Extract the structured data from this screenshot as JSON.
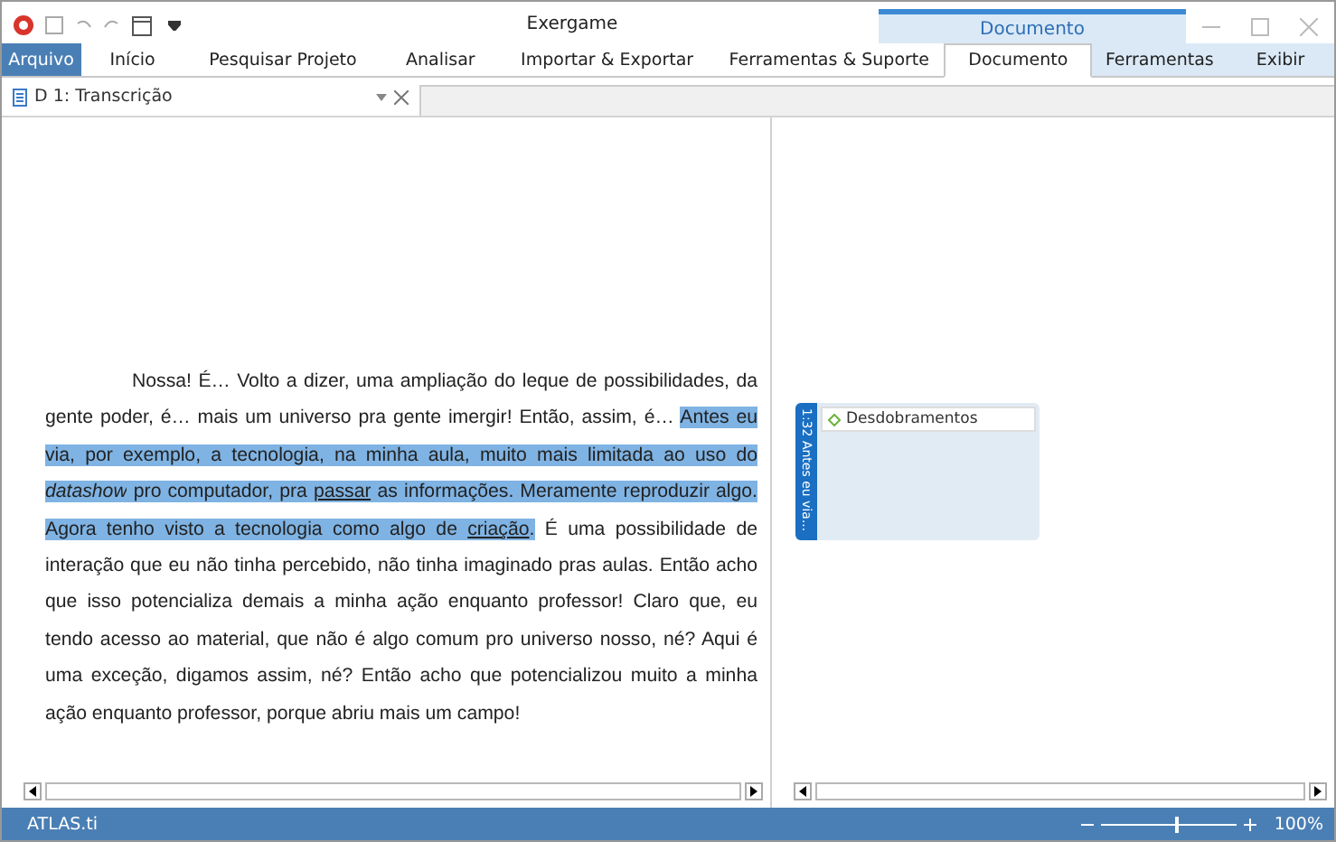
{
  "window": {
    "title": "Exergame",
    "context_group": "Documento"
  },
  "ribbon_tabs": [
    {
      "label": "Arquivo",
      "kind": "file",
      "selected": false
    },
    {
      "label": "Início",
      "kind": "tab",
      "selected": false
    },
    {
      "label": "Pesquisar Projeto",
      "kind": "tab",
      "selected": false
    },
    {
      "label": "Analisar",
      "kind": "tab",
      "selected": false
    },
    {
      "label": "Importar & Exportar",
      "kind": "tab",
      "selected": false
    },
    {
      "label": "Ferramentas & Suporte",
      "kind": "tab",
      "selected": false
    },
    {
      "label": "Documento",
      "kind": "context",
      "selected": true
    },
    {
      "label": "Ferramentas",
      "kind": "context",
      "selected": false
    },
    {
      "label": "Exibir",
      "kind": "context",
      "selected": false
    }
  ],
  "document_tab": {
    "title": "D 1: Transcrição"
  },
  "transcript": [
    {
      "text": "Nossa! É… Volto a dizer, uma ampliação do leque de possibilidades, da gente poder, é… mais um universo pra gente imergir! Então, assim, é… ",
      "highlighted": false,
      "kind": "plain"
    },
    {
      "text": "Antes eu via, por exemplo, a tecnologia, na minha aula, muito mais limitada ao uso do ",
      "highlighted": true,
      "kind": "plain"
    },
    {
      "text": "datashow",
      "highlighted": true,
      "kind": "italic"
    },
    {
      "text": " pro computador, pra ",
      "highlighted": true,
      "kind": "plain"
    },
    {
      "text": "passar",
      "highlighted": true,
      "kind": "underline"
    },
    {
      "text": " as informações. Meramente reproduzir algo. Agora tenho visto a tecnologia como algo de ",
      "highlighted": true,
      "kind": "plain"
    },
    {
      "text": "criação",
      "highlighted": true,
      "kind": "underline"
    },
    {
      "text": ".",
      "highlighted": true,
      "kind": "plain"
    },
    {
      "text": " É uma possibilidade de interação que eu não tinha percebido, não tinha imaginado pras aulas. Então acho que isso potencializa demais a minha ação enquanto professor! Claro que, eu tendo acesso ao material, que não é algo comum pro universo nosso, né? Aqui é uma exceção, digamos assim, né? Então acho que potencializou muito a minha ação enquanto professor, porque abriu mais um campo!",
      "highlighted": false,
      "kind": "plain"
    }
  ],
  "quotation": {
    "label": "1:32 Antes eu via...",
    "codes": [
      "Desdobramentos"
    ]
  },
  "status_bar": {
    "app": "ATLAS.ti",
    "zoom": "100%",
    "zoom_slider": {
      "level": 0.55
    }
  }
}
